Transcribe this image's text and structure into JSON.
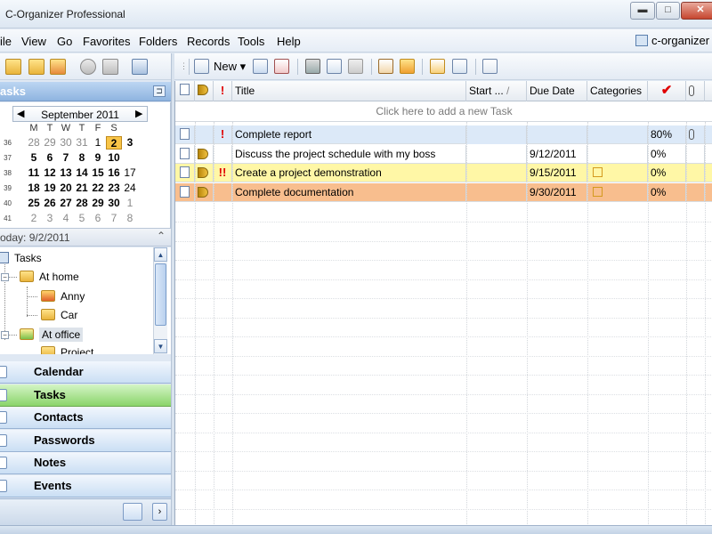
{
  "window": {
    "title": "C-Organizer Professional",
    "min": "▬",
    "max": "□",
    "close": "✕"
  },
  "menu": [
    "ile",
    "View",
    "Go",
    "Favorites",
    "Folders",
    "Records",
    "Tools",
    "Help"
  ],
  "brand": "c-organizer",
  "left_panel": {
    "title": "asks",
    "pin": "⊐",
    "calendar": {
      "month": "September 2011",
      "prev": "◀",
      "next": "▶",
      "dow": [
        "M",
        "T",
        "W",
        "T",
        "F",
        "S"
      ],
      "weeks": [
        "36",
        "37",
        "38",
        "39",
        "40",
        "41"
      ],
      "rows": [
        [
          "28",
          "29",
          "30",
          "31",
          "1",
          "2",
          "3"
        ],
        [
          "5",
          "6",
          "7",
          "8",
          "9",
          "10",
          ""
        ],
        [
          "11",
          "12",
          "13",
          "14",
          "15",
          "16",
          "17"
        ],
        [
          "18",
          "19",
          "20",
          "21",
          "22",
          "23",
          "24"
        ],
        [
          "25",
          "26",
          "27",
          "28",
          "29",
          "30",
          "1"
        ],
        [
          "2",
          "3",
          "4",
          "5",
          "6",
          "7",
          "8"
        ]
      ]
    },
    "today": "oday: 9/2/2011",
    "collapse": "⌃",
    "tree": [
      {
        "label": "Tasks"
      },
      {
        "label": "At home"
      },
      {
        "label": "Anny"
      },
      {
        "label": "Car"
      },
      {
        "label": "At office"
      },
      {
        "label": "Project"
      }
    ],
    "tree_expanders": [
      "−",
      "−"
    ],
    "scroll": {
      "up": "▲",
      "down": "▼"
    },
    "nav": [
      "Calendar",
      "Tasks",
      "Contacts",
      "Passwords",
      "Notes",
      "Events"
    ],
    "nav_active": "Tasks",
    "nav_more": "›"
  },
  "toolbar": {
    "grip": "⋮",
    "new_label": "New ▾"
  },
  "grid": {
    "headers": {
      "title": "Title",
      "start": "Start ...",
      "sort_indicator": "/",
      "due": "Due Date",
      "categories": "Categories",
      "complete": "✔",
      "priority": "!"
    },
    "add_row": "Click here to add a new Task",
    "rows": [
      {
        "priority": "!",
        "title": "Complete report",
        "due": "",
        "complete": "80%",
        "attach": "📎",
        "bg": "#dce9f8"
      },
      {
        "priority": "",
        "title": "Discuss the project schedule with my boss",
        "due": "9/12/2011",
        "complete": "0%",
        "attach": "",
        "bg": "#ffffff"
      },
      {
        "priority": "!!",
        "title": "Create a project demonstration",
        "due": "9/15/2011",
        "complete": "0%",
        "attach": "",
        "bg": "#fff7a6"
      },
      {
        "priority": "",
        "title": "Complete documentation",
        "due": "9/30/2011",
        "complete": "0%",
        "attach": "",
        "bg": "#f8be8e"
      }
    ]
  },
  "colors": {
    "accent": "#8fb4e0",
    "active_nav": "#8ad46a",
    "selected_day": "#f8c548",
    "priority_red": "#e00000"
  }
}
